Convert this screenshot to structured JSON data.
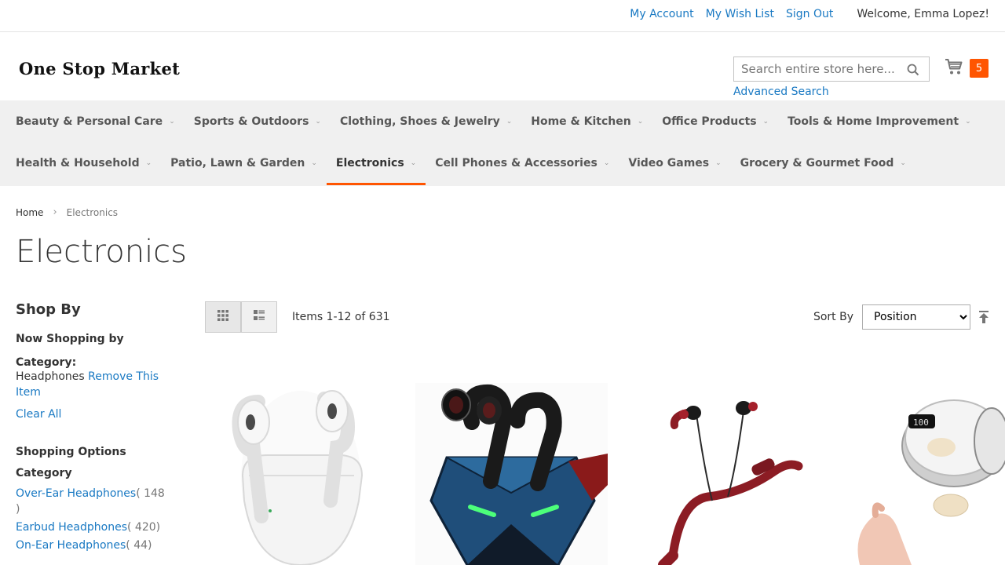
{
  "header": {
    "links": [
      "My Account",
      "My Wish List",
      "Sign Out"
    ],
    "welcome": "Welcome, Emma Lopez!",
    "logo_text": "One Stop Market",
    "search_placeholder": "Search entire store here...",
    "advanced_search": "Advanced Search",
    "cart_count": "5"
  },
  "nav": {
    "row1": [
      "Beauty & Personal Care",
      "Sports & Outdoors",
      "Clothing, Shoes & Jewelry",
      "Home & Kitchen",
      "Office Products",
      "Tools & Home Improvement"
    ],
    "row2": [
      "Health & Household",
      "Patio, Lawn & Garden",
      "Electronics",
      "Cell Phones & Accessories",
      "Video Games",
      "Grocery & Gourmet Food"
    ],
    "active": "Electronics"
  },
  "breadcrumb": {
    "home": "Home",
    "current": "Electronics"
  },
  "page_title": "Electronics",
  "sidebar": {
    "shop_by": "Shop By",
    "now_shopping": "Now Shopping by",
    "filter_label": "Category:",
    "filter_value": "Headphones",
    "remove": "Remove This Item",
    "clear_all": "Clear All",
    "shopping_options": "Shopping Options",
    "category": "Category",
    "categories": [
      {
        "name": "Over-Ear Headphones",
        "count": "( 148 )"
      },
      {
        "name": "Earbud Headphones",
        "count": "( 420)"
      },
      {
        "name": "On-Ear Headphones",
        "count": "( 44)"
      }
    ]
  },
  "toolbar": {
    "amount": "Items 1-12 of 631",
    "sort_label": "Sort By",
    "sort_selected": "Position"
  },
  "colors": {
    "accent": "#ff5501",
    "link": "#1979c3",
    "nav_bg": "#f0f0f0"
  },
  "products": [
    {
      "icon": "white-earbuds-image"
    },
    {
      "icon": "gaming-earbuds-image"
    },
    {
      "icon": "neckband-earphones-image"
    },
    {
      "icon": "mini-earbud-image"
    }
  ]
}
